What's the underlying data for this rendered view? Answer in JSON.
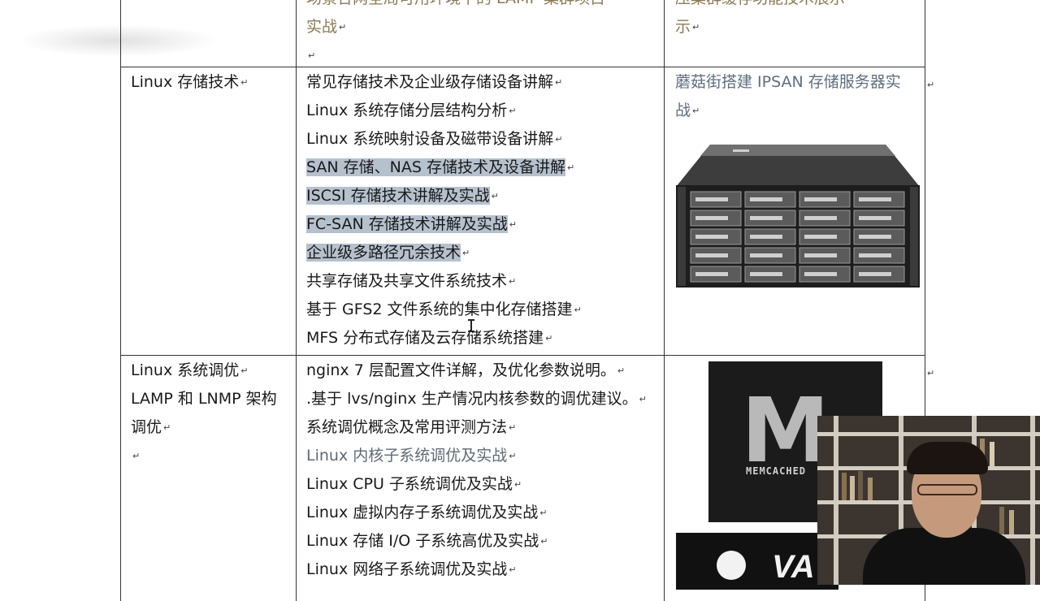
{
  "top_row": {
    "col2_partial_line": "场景合网全局可用环境下的 LAMP 集群项目",
    "col2_line": "实战",
    "col3_partial_line": "压集群缓存功能技术展示",
    "col3_line": "示"
  },
  "storage_row": {
    "category": "Linux 存储技术",
    "items": [
      {
        "text": "常见存储技术及企业级存储设备讲解",
        "highlight": false
      },
      {
        "text": "Linux 系统存储分层结构分析",
        "highlight": false
      },
      {
        "text": "Linux 系统映射设备及磁带设备讲解",
        "highlight": false
      },
      {
        "text": "SAN 存储、NAS 存储技术及设备讲解",
        "highlight": true
      },
      {
        "text": "ISCSI 存储技术讲解及实战",
        "highlight": true
      },
      {
        "text": "FC-SAN 存储技术讲解及实战",
        "highlight": true
      },
      {
        "text": "企业级多路径冗余技术",
        "highlight": true
      },
      {
        "text": "共享存储及共享文件系统技术",
        "highlight": false
      },
      {
        "text": "基于 GFS2 文件系统的集中化存储搭建",
        "highlight": false
      },
      {
        "text": "MFS 分布式存储及云存储系统搭建",
        "highlight": false
      }
    ],
    "project_lines": [
      "蘑菇街搭建 IPSAN 存储服务器实",
      "战"
    ],
    "image": "storage-server-icon"
  },
  "tuning_row": {
    "category_lines": [
      "Linux 系统调优",
      "LAMP 和 LNMP 架构",
      "调优"
    ],
    "items": [
      {
        "text": "nginx 7 层配置文件详解，及优化参数说明。",
        "gray": false
      },
      {
        "text": ".基于 lvs/nginx 生产情况内核参数的调优建议。",
        "gray": false
      },
      {
        "text": "系统调优概念及常用评测方法",
        "gray": false
      },
      {
        "text": "Linux  内核子系统调优及实战",
        "gray": true
      },
      {
        "text": "Linux CPU 子系统调优及实战",
        "gray": false
      },
      {
        "text": "Linux 虚拟内存子系统调优及实战",
        "gray": false
      },
      {
        "text": "Linux 存储 I/O 子系统高优及实战",
        "gray": false
      },
      {
        "text": "Linux 网络子系统调优及实战",
        "gray": false
      }
    ],
    "logo_text": "MEMCACHED",
    "logo_letter": "M",
    "second_logo_text": "VA"
  },
  "paragraph_mark": "↵",
  "colors": {
    "highlight": "#b6c1ce",
    "gray_text": "#5f6a73",
    "border": "#333333"
  }
}
